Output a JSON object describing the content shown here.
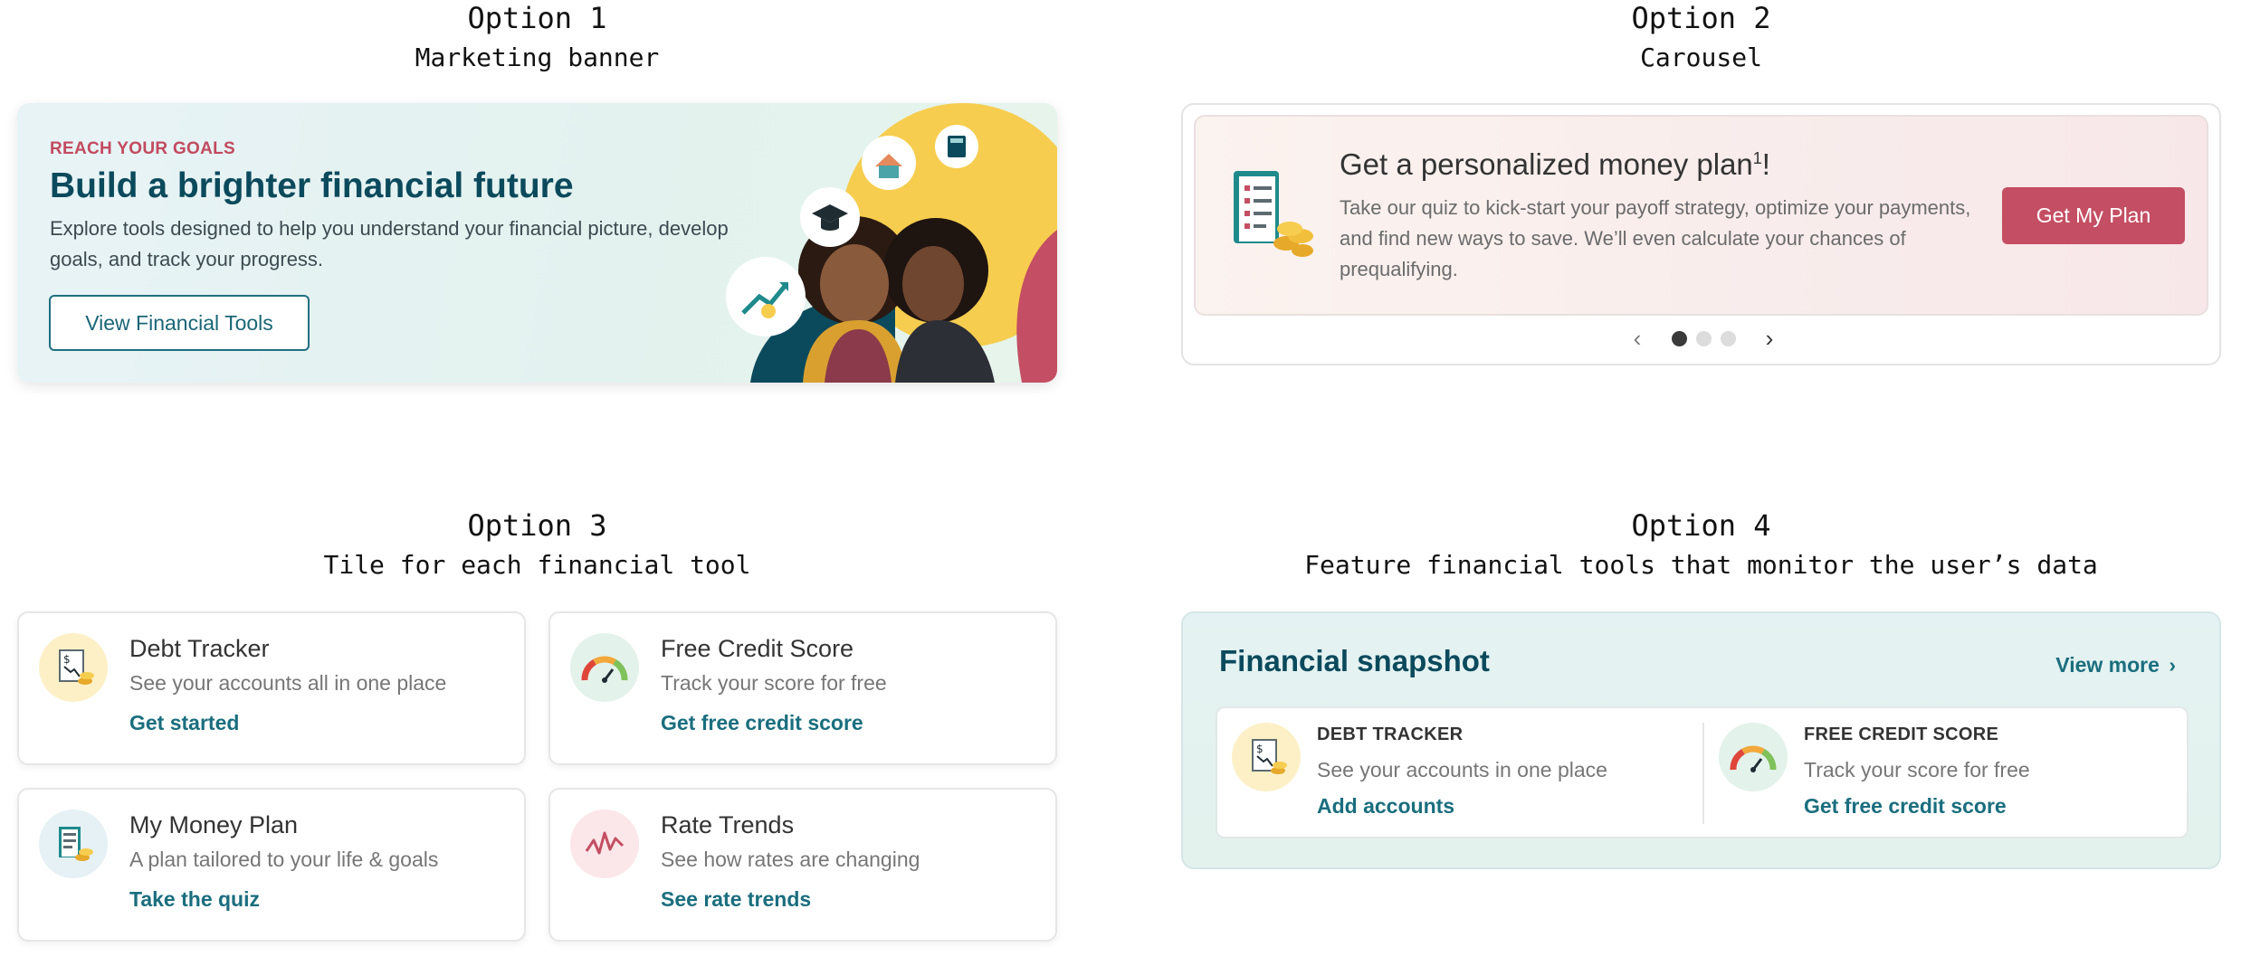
{
  "option1": {
    "heading": "Option 1",
    "subheading": "Marketing banner",
    "banner": {
      "eyebrow": "REACH YOUR GOALS",
      "headline": "Build a brighter financial future",
      "description": "Explore tools designed to help you understand your financial picture, develop goals, and track your progress.",
      "cta_label": "View Financial  Tools"
    }
  },
  "option2": {
    "heading": "Option 2",
    "subheading": "Carousel",
    "slide": {
      "title": "Get a personalized money plan",
      "title_superscript": "1",
      "title_suffix": "!",
      "body": "Take our quiz to kick-start your payoff strategy, optimize your payments, and find new ways to save. We’ll even calculate your chances of prequalifying.",
      "button_label": "Get My Plan"
    },
    "pager": {
      "prev": "‹",
      "next": "›",
      "current_slide": 1,
      "total_slides": 3
    }
  },
  "option3": {
    "heading": "Option 3",
    "subheading": "Tile for each financial tool",
    "tiles": [
      {
        "title": "Debt Tracker",
        "subtitle": "See your accounts all in one place",
        "link": "Get started",
        "icon": "debt-tracker-icon"
      },
      {
        "title": "Free Credit Score",
        "subtitle": "Track your score for free",
        "link": "Get free credit score",
        "icon": "credit-gauge-icon"
      },
      {
        "title": "My Money Plan",
        "subtitle": "A plan tailored to your life & goals",
        "link": "Take the quiz",
        "icon": "money-plan-icon"
      },
      {
        "title": "Rate Trends",
        "subtitle": "See how rates are changing",
        "link": "See rate trends",
        "icon": "rate-trends-icon"
      }
    ]
  },
  "option4": {
    "heading": "Option 4",
    "subheading": "Feature financial tools that monitor the user’s data",
    "snapshot": {
      "title": "Financial snapshot",
      "view_more": "View more",
      "items": [
        {
          "heading": "DEBT TRACKER",
          "subtitle": "See your accounts in one place",
          "link": "Add accounts",
          "icon": "debt-tracker-icon"
        },
        {
          "heading": "FREE CREDIT SCORE",
          "subtitle": "Track your score for free",
          "link": "Get free credit score",
          "icon": "credit-gauge-icon"
        }
      ]
    }
  },
  "colors": {
    "brand_teal": "#0b4a5c",
    "link_teal": "#1a6e7e",
    "accent_rose": "#c44e63",
    "eyebrow_rose": "#c24a60",
    "sun_yellow": "#f7cd4f"
  }
}
